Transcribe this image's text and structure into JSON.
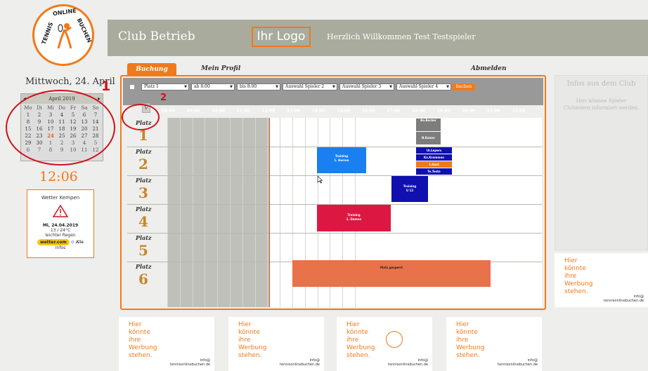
{
  "logo": {
    "arc_top": "ONLINE",
    "arc_left": "TENNIS",
    "arc_right": "BUCHEN"
  },
  "header": {
    "title": "Club Betrieb",
    "logo_placeholder": "Ihr Logo",
    "welcome": "Herzlich Willkommen Test Testspieler"
  },
  "date": "Mittwoch, 24. April",
  "calendar": {
    "month": "April 2019",
    "prev": "◂",
    "next": "▸",
    "weekdays": [
      "Mo",
      "Di",
      "Mi",
      "Do",
      "Fr",
      "Sa",
      "So"
    ],
    "rows": [
      [
        "1",
        "2",
        "3",
        "4",
        "5",
        "6",
        "7"
      ],
      [
        "8",
        "9",
        "10",
        "11",
        "12",
        "13",
        "14"
      ],
      [
        "15",
        "16",
        "17",
        "18",
        "19",
        "20",
        "21"
      ],
      [
        "22",
        "23",
        "24",
        "25",
        "26",
        "27",
        "28"
      ],
      [
        "29",
        "30",
        "1",
        "2",
        "3",
        "4",
        "5"
      ],
      [
        "6",
        "7",
        "8",
        "9",
        "10",
        "11",
        "12"
      ]
    ]
  },
  "clock": "12:06",
  "weather": {
    "title": "Wetter Kempen",
    "date": "Mi, 24.04.2019",
    "temp": "13 / 24°C",
    "desc": "leichter Regen",
    "brand": "wetter.com",
    "link": "Alle",
    "link2": "Infos"
  },
  "annotations": {
    "one": "1",
    "two": "2"
  },
  "tabs": {
    "booking": "Buchung",
    "profile": "Mein Profil",
    "logout": "Abmelden"
  },
  "toolbar": {
    "court": "Platz 1",
    "from": "ab  8:00",
    "to": "bis  8:00",
    "player2": "Auswahl Spieler 2",
    "player3": "Auswahl Spieler 3",
    "player4": "Auswahl Spieler 4",
    "book": "buchen",
    "dropdown_arrow": "▼"
  },
  "picker": "V",
  "hours": [
    "08:00",
    "09:00",
    "10:00",
    "11:00",
    "12:00",
    "13:00",
    "14:00",
    "15:00",
    "16:00",
    "17:00",
    "18:00",
    "19:00",
    "20:00",
    "21:00",
    "22:00"
  ],
  "courts": [
    {
      "label": "Platz",
      "num": "1"
    },
    {
      "label": "Platz",
      "num": "2"
    },
    {
      "label": "Platz",
      "num": "3"
    },
    {
      "label": "Platz",
      "num": "4"
    },
    {
      "label": "Platz",
      "num": "5"
    },
    {
      "label": "Platz",
      "num": "6"
    }
  ],
  "bookings": {
    "b1": "Bo.Becker",
    "b2": "N.Kaiser",
    "t1a": "Training",
    "t1b": "1. Herren",
    "u1": "Ur.Lepers",
    "u2": "Ka.Kremmen",
    "u3": "1.Gast",
    "u4": "Te.Testo",
    "t2a": "Training",
    "t2b": "U 12",
    "t3a": "Training",
    "t3b": "1. Damen",
    "closed": "Platz gesperrt"
  },
  "colors": {
    "accent": "#f07a1a",
    "blue": "#1a7ff0",
    "navy": "#1010b0",
    "crimson": "#dc1842",
    "gray": "#7d7d7d",
    "closed": "#e8724a"
  },
  "info": {
    "title": "Infos aus dem Club",
    "body1": "Hier können Spieler",
    "body2": "Clubintern informiert werden."
  },
  "ad": {
    "l1": "Hier",
    "l2": "könnte",
    "l3": "ihre",
    "l4": "Werbung",
    "l5": "stehen.",
    "info": "info@",
    "site": "tennisonlinebuchen.de"
  }
}
